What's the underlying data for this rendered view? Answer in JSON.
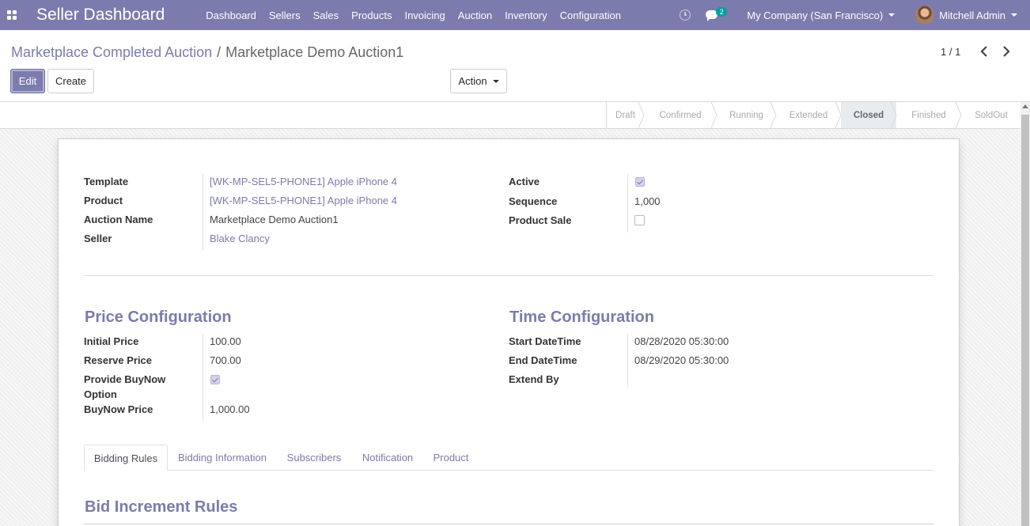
{
  "navbar": {
    "brand": "Seller Dashboard",
    "menu": [
      "Dashboard",
      "Sellers",
      "Sales",
      "Products",
      "Invoicing",
      "Auction",
      "Inventory",
      "Configuration"
    ],
    "chat_count": "2",
    "company": "My Company (San Francisco)",
    "user": "Mitchell Admin"
  },
  "breadcrumb": {
    "parent": "Marketplace Completed Auction",
    "separator": "/",
    "current": "Marketplace Demo Auction1"
  },
  "buttons": {
    "edit": "Edit",
    "create": "Create",
    "action": "Action"
  },
  "pager": "1 / 1",
  "stages": [
    "Draft",
    "Confirmed",
    "Running",
    "Extended",
    "Closed",
    "Finished",
    "SoldOut"
  ],
  "active_stage": "Closed",
  "fields": {
    "template_label": "Template",
    "template_value": "[WK-MP-SEL5-PHONE1] Apple iPhone 4",
    "product_label": "Product",
    "product_value": "[WK-MP-SEL5-PHONE1] Apple iPhone 4",
    "auction_name_label": "Auction Name",
    "auction_name_value": "Marketplace Demo Auction1",
    "seller_label": "Seller",
    "seller_value": "Blake Clancy",
    "active_label": "Active",
    "active_checked": true,
    "sequence_label": "Sequence",
    "sequence_value": "1,000",
    "product_sale_label": "Product Sale",
    "product_sale_checked": false
  },
  "price_config": {
    "title": "Price Configuration",
    "initial_price_label": "Initial Price",
    "initial_price_value": "100.00",
    "reserve_price_label": "Reserve Price",
    "reserve_price_value": "700.00",
    "buynow_option_label_1": "Provide BuyNow",
    "buynow_option_label_2": "Option",
    "buynow_option_checked": true,
    "buynow_price_label": "BuyNow Price",
    "buynow_price_value": "1,000.00"
  },
  "time_config": {
    "title": "Time Configuration",
    "start_label": "Start DateTime",
    "start_value": "08/28/2020 05:30:00",
    "end_label": "End DateTime",
    "end_value": "08/29/2020 05:30:00",
    "extend_by_label": "Extend By"
  },
  "tabs": [
    "Bidding Rules",
    "Bidding Information",
    "Subscribers",
    "Notification",
    "Product"
  ],
  "active_tab": "Bidding Rules",
  "bid_rules_title": "Bid Increment Rules",
  "colors": {
    "brand": "#7c7bad",
    "badge": "#00a09d"
  }
}
